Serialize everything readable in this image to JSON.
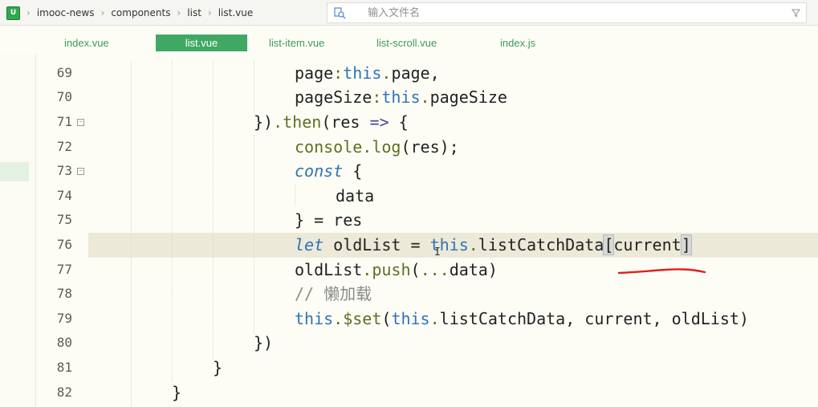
{
  "breadcrumb": {
    "logo_text": "U",
    "items": [
      "imooc-news",
      "components",
      "list",
      "list.vue"
    ]
  },
  "search": {
    "placeholder": "输入文件名",
    "value": ""
  },
  "tabs": [
    {
      "label": "index.vue",
      "active": false
    },
    {
      "label": "list.vue",
      "active": true
    },
    {
      "label": "list-item.vue",
      "active": false
    },
    {
      "label": "list-scroll.vue",
      "active": false
    },
    {
      "label": "index.js",
      "active": false
    }
  ],
  "editor": {
    "line_numbers": [
      "69",
      "70",
      "71",
      "72",
      "73",
      "74",
      "75",
      "76",
      "77",
      "78",
      "79",
      "80",
      "81",
      "82"
    ],
    "fold_glyph": "−",
    "lines": [
      "page:this.page,",
      "pageSize:this.pageSize",
      "}).then(res => {",
      "console.log(res);",
      "const {",
      "data",
      "} = res",
      "let oldList = this.listCatchData[current]",
      "oldList.push(...data)",
      "// 懒加载",
      "this.$set(this.listCatchData, current, oldList)",
      "})",
      "}",
      "}"
    ]
  },
  "colors": {
    "accent": "#41a863",
    "keyword": "#2d73b8",
    "annotation_underline": "#e0201c"
  }
}
